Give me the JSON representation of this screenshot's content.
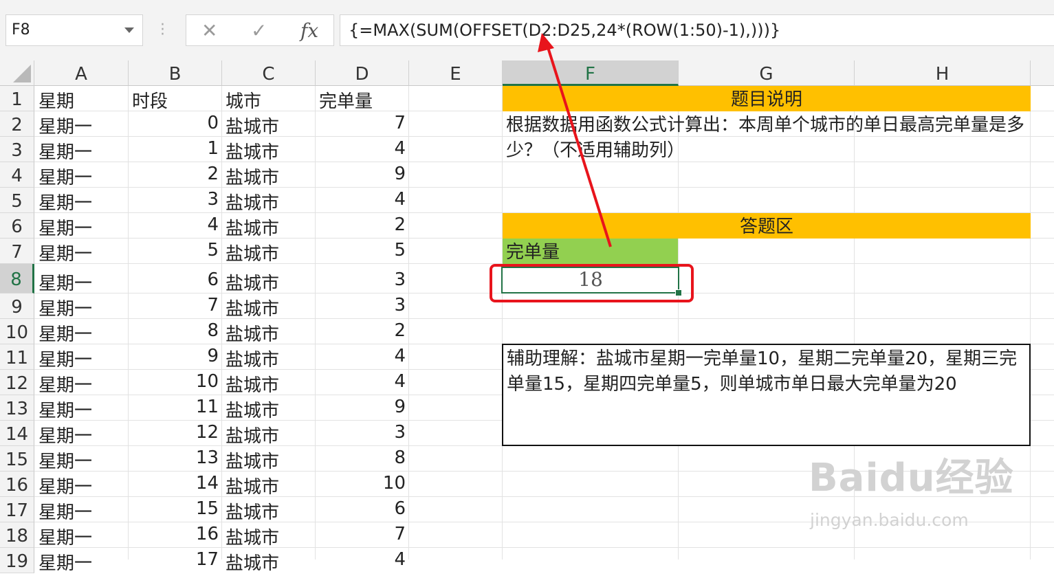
{
  "formula_bar": {
    "name_box": "F8",
    "cancel_icon": "✕",
    "confirm_icon": "✓",
    "fx_label": "fx",
    "formula": "{=MAX(SUM(OFFSET(D2:D25,24*(ROW(1:50)-1),)))}"
  },
  "columns": [
    "A",
    "B",
    "C",
    "D",
    "E",
    "F",
    "G",
    "H"
  ],
  "selected_column": "F",
  "selected_row": "8",
  "header_row": {
    "A": "星期",
    "B": "时段",
    "C": "城市",
    "D": "完单量"
  },
  "rows": [
    {
      "num": "2",
      "day": "星期一",
      "slot": "0",
      "city": "盐城市",
      "qty": "7"
    },
    {
      "num": "3",
      "day": "星期一",
      "slot": "1",
      "city": "盐城市",
      "qty": "4"
    },
    {
      "num": "4",
      "day": "星期一",
      "slot": "2",
      "city": "盐城市",
      "qty": "9"
    },
    {
      "num": "5",
      "day": "星期一",
      "slot": "3",
      "city": "盐城市",
      "qty": "4"
    },
    {
      "num": "6",
      "day": "星期一",
      "slot": "4",
      "city": "盐城市",
      "qty": "2"
    },
    {
      "num": "7",
      "day": "星期一",
      "slot": "5",
      "city": "盐城市",
      "qty": "5"
    },
    {
      "num": "8",
      "day": "星期一",
      "slot": "6",
      "city": "盐城市",
      "qty": "3"
    },
    {
      "num": "9",
      "day": "星期一",
      "slot": "7",
      "city": "盐城市",
      "qty": "3"
    },
    {
      "num": "10",
      "day": "星期一",
      "slot": "8",
      "city": "盐城市",
      "qty": "2"
    },
    {
      "num": "11",
      "day": "星期一",
      "slot": "9",
      "city": "盐城市",
      "qty": "4"
    },
    {
      "num": "12",
      "day": "星期一",
      "slot": "10",
      "city": "盐城市",
      "qty": "4"
    },
    {
      "num": "13",
      "day": "星期一",
      "slot": "11",
      "city": "盐城市",
      "qty": "9"
    },
    {
      "num": "14",
      "day": "星期一",
      "slot": "12",
      "city": "盐城市",
      "qty": "3"
    },
    {
      "num": "15",
      "day": "星期一",
      "slot": "13",
      "city": "盐城市",
      "qty": "8"
    },
    {
      "num": "16",
      "day": "星期一",
      "slot": "14",
      "city": "盐城市",
      "qty": "10"
    },
    {
      "num": "17",
      "day": "星期一",
      "slot": "15",
      "city": "盐城市",
      "qty": "6"
    },
    {
      "num": "18",
      "day": "星期一",
      "slot": "16",
      "city": "盐城市",
      "qty": "7"
    },
    {
      "num": "19",
      "day": "星期一",
      "slot": "17",
      "city": "盐城市",
      "qty": "4"
    }
  ],
  "title_banner": "题目说明",
  "description": "根据数据用函数公式计算出：本周单个城市的单日最高完单量是多少？（不适用辅助列）",
  "answer_banner": "答题区",
  "answer_label": "完单量",
  "answer_value": "18",
  "helper_note": "辅助理解：盐城市星期一完单量10，星期二完单量20，星期三完单量15，星期四完单量5，则单城市单日最大完单量为20",
  "watermark": {
    "logo": "Baidu经验",
    "url": "jingyan.baidu.com"
  },
  "colors": {
    "orange_banner": "#ffc000",
    "green_label": "#92d050",
    "selection": "#217346",
    "annotation": "#e8141c"
  }
}
